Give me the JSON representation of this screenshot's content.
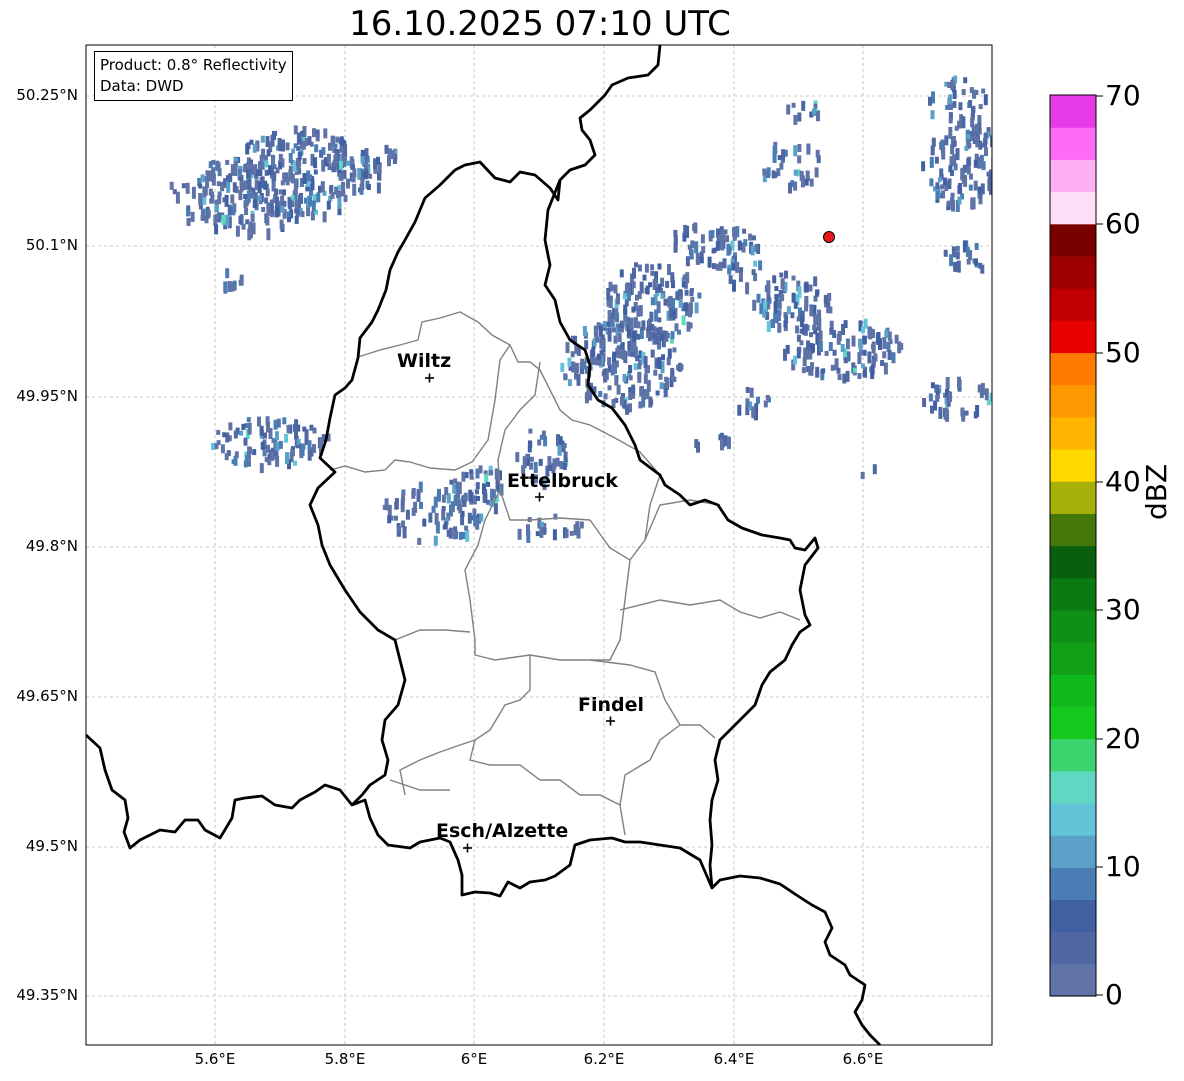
{
  "title": "16.10.2025 07:10 UTC",
  "info": {
    "product": "Product: 0.8° Reflectivity",
    "data": "Data: DWD"
  },
  "lat_ticks": [
    "50.25°N",
    "50.1°N",
    "49.95°N",
    "49.8°N",
    "49.65°N",
    "49.5°N",
    "49.35°N"
  ],
  "lon_ticks": [
    "5.6°E",
    "5.8°E",
    "6°E",
    "6.2°E",
    "6.4°E",
    "6.6°E"
  ],
  "cities": [
    {
      "name": "Wiltz",
      "lon": 5.93,
      "lat": 49.967
    },
    {
      "name": "Ettelbruck",
      "lon": 6.1,
      "lat": 49.848
    },
    {
      "name": "Findel",
      "lon": 6.21,
      "lat": 49.627
    },
    {
      "name": "Esch/Alzette",
      "lon": 5.99,
      "lat": 49.498
    }
  ],
  "marker": {
    "lon": 6.54,
    "lat": 50.11,
    "color": "#e8191c"
  },
  "colorbar": {
    "title": "dBZ",
    "ticks": [
      "0",
      "10",
      "20",
      "30",
      "40",
      "50",
      "60",
      "70"
    ],
    "min": 0,
    "max": 70,
    "colors": [
      "#5f73a7",
      "#4f67a3",
      "#4060a1",
      "#4a7db3",
      "#5aa0c7",
      "#63c3d9",
      "#5fd7c3",
      "#3dd46f",
      "#14c81e",
      "#12b91c",
      "#109f17",
      "#0f8f16",
      "#0c7a12",
      "#0a5f0e",
      "#46770a",
      "#a7b00a",
      "#ffd800",
      "#ffb400",
      "#ff9700",
      "#ff7a00",
      "#e60000",
      "#c00000",
      "#9c0000",
      "#7a0000",
      "#ffdff7",
      "#ffb0f5",
      "#ff6bf5",
      "#e83be8"
    ]
  }
}
